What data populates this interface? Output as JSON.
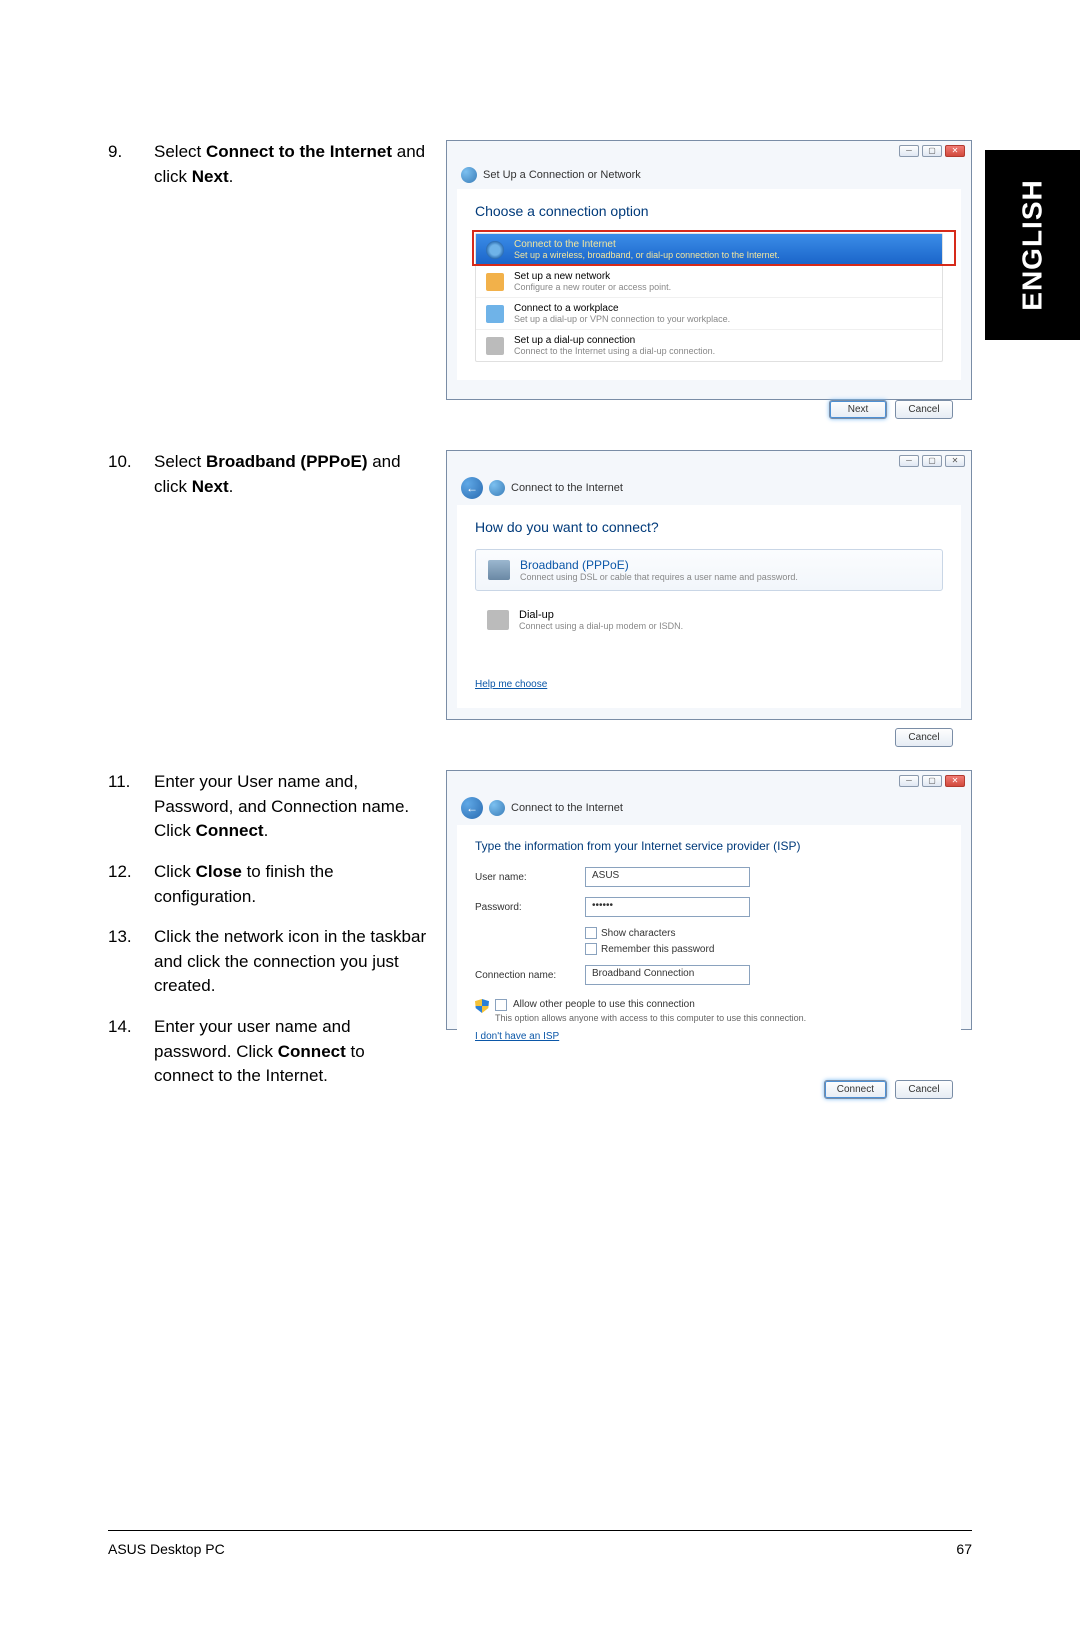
{
  "side_tab": "ENGLISH",
  "footer": {
    "left": "ASUS Desktop PC",
    "right": "67"
  },
  "steps": {
    "s9": {
      "num": "9.",
      "text_pre": "Select ",
      "bold1": "Connect to the Internet",
      "mid": " and click ",
      "bold2": "Next",
      "post": "."
    },
    "s10": {
      "num": "10.",
      "text_pre": "Select ",
      "bold1": "Broadband (PPPoE)",
      "mid": " and click ",
      "bold2": "Next",
      "post": "."
    },
    "s11": {
      "num": "11.",
      "text": "Enter your User name and, Password, and Connection name. Click ",
      "bold": "Connect",
      "post": "."
    },
    "s12": {
      "num": "12.",
      "pre": "Click ",
      "bold": "Close",
      "post": " to finish the configuration."
    },
    "s13": {
      "num": "13.",
      "text": "Click the network icon in the taskbar and click the connection you just created."
    },
    "s14": {
      "num": "14.",
      "pre": "Enter your user name and password. Click ",
      "bold": "Connect",
      "post": " to connect to the Internet."
    }
  },
  "win1": {
    "title": "Set Up a Connection or Network",
    "heading": "Choose a connection option",
    "options": [
      {
        "t1": "Connect to the Internet",
        "t2": "Set up a wireless, broadband, or dial-up connection to the Internet."
      },
      {
        "t1": "Set up a new network",
        "t2": "Configure a new router or access point."
      },
      {
        "t1": "Connect to a workplace",
        "t2": "Set up a dial-up or VPN connection to your workplace."
      },
      {
        "t1": "Set up a dial-up connection",
        "t2": "Connect to the Internet using a dial-up connection."
      }
    ],
    "next": "Next",
    "cancel": "Cancel"
  },
  "win2": {
    "title": "Connect to the Internet",
    "heading": "How do you want to connect?",
    "opt1": {
      "t1": "Broadband (PPPoE)",
      "t2": "Connect using DSL or cable that requires a user name and password."
    },
    "opt2": {
      "t1": "Dial-up",
      "t2": "Connect using a dial-up modem or ISDN."
    },
    "help": "Help me choose",
    "cancel": "Cancel"
  },
  "win3": {
    "title": "Connect to the Internet",
    "heading": "Type the information from your Internet service provider (ISP)",
    "user_label": "User name:",
    "user_value": "ASUS",
    "pass_label": "Password:",
    "pass_value": "••••••",
    "show_chars": "Show characters",
    "remember": "Remember this password",
    "conn_label": "Connection name:",
    "conn_value": "Broadband Connection",
    "allow_label": "Allow other people to use this connection",
    "allow_sub": "This option allows anyone with access to this computer to use this connection.",
    "no_isp": "I don't have an ISP",
    "connect": "Connect",
    "cancel": "Cancel"
  }
}
